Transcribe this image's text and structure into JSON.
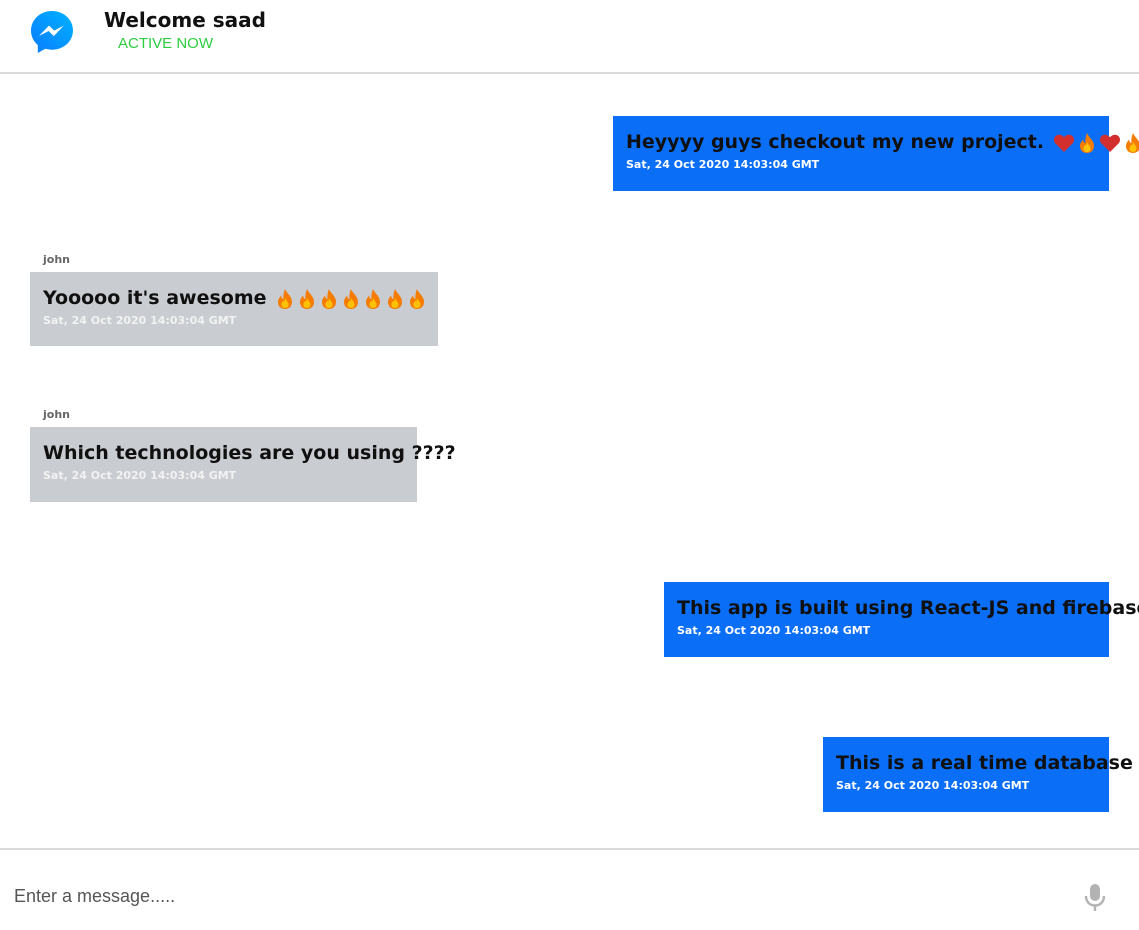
{
  "header": {
    "logo_icon": "messenger-logo-icon",
    "title": "Welcome saad",
    "status": "ACTIVE NOW",
    "status_color": "#2ecc40"
  },
  "colors": {
    "my_bubble": "#0a6ef7",
    "their_bubble": "#c9ccd1"
  },
  "messages": [
    {
      "from": "me",
      "sender": "",
      "text": "Heyyyy guys checkout my new project.",
      "emojis": [
        "heart",
        "fire",
        "heart",
        "fire"
      ],
      "time": "Sat, 24 Oct 2020 14:03:04 GMT"
    },
    {
      "from": "them",
      "sender": "john",
      "text": "Yooooo it's awesome",
      "emojis": [
        "fire",
        "fire",
        "fire",
        "fire",
        "fire",
        "fire",
        "fire"
      ],
      "time": "Sat, 24 Oct 2020 14:03:04 GMT"
    },
    {
      "from": "them",
      "sender": "john",
      "text": "Which technologies are you using ????",
      "emojis": [],
      "time": "Sat, 24 Oct 2020 14:03:04 GMT"
    },
    {
      "from": "me",
      "sender": "",
      "text": "This app is built using React-JS and firebase",
      "emojis": [],
      "time": "Sat, 24 Oct 2020 14:03:04 GMT"
    },
    {
      "from": "me",
      "sender": "",
      "text": "This is a real time database",
      "emojis": [],
      "time": "Sat, 24 Oct 2020 14:03:04 GMT"
    }
  ],
  "composer": {
    "placeholder": "Enter a message.....",
    "value": "",
    "mic_icon": "microphone-icon"
  }
}
